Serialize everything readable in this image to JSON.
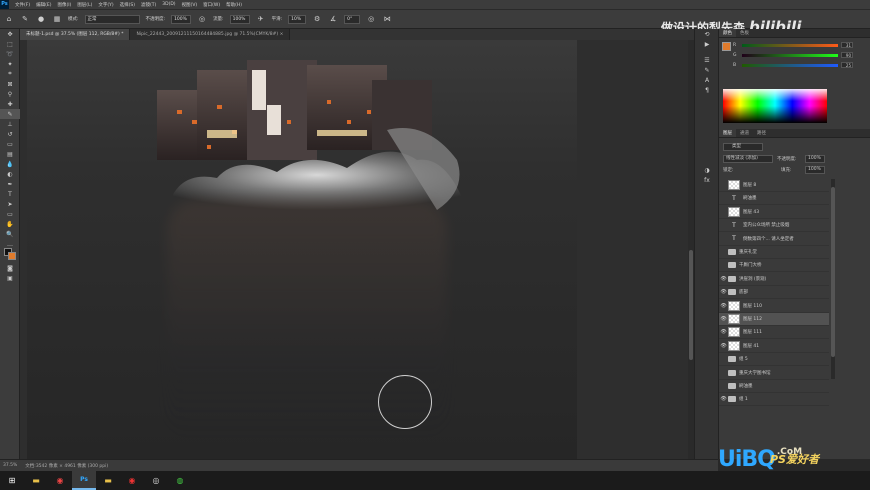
{
  "app": {
    "logo": "Ps"
  },
  "menu": [
    "文件(F)",
    "编辑(E)",
    "图像(I)",
    "图层(L)",
    "文字(Y)",
    "选择(S)",
    "滤镜(T)",
    "3D(D)",
    "视图(V)",
    "窗口(W)",
    "帮助(H)"
  ],
  "options": {
    "mode_label": "模式:",
    "mode_value": "正常",
    "opacity_label": "不透明度:",
    "opacity_value": "100%",
    "flow_label": "流量:",
    "flow_value": "100%",
    "smooth_label": "平滑:",
    "smooth_value": "10%",
    "angle_value": "0°"
  },
  "tabs": [
    {
      "label": "未标题-1.psd @ 37.5% (图层 112, RGB/8#) *"
    },
    {
      "label": "Nipic_22443_20091211150164484885.jpg @ 71.5%(CMYK/8#) ×"
    }
  ],
  "watermark": {
    "text": "做设计的梨先森",
    "brand": "bilibili"
  },
  "color_panel": {
    "tabs": [
      "颜色",
      "色板"
    ],
    "r": "31",
    "g": "90",
    "b": "25",
    "accent": "#e07b2c"
  },
  "adjust_tabs": [
    "图层",
    "通道",
    "路径"
  ],
  "layers_panel": {
    "kind_filter": "类型",
    "blend_mode": "线性减淡 (添加)",
    "opacity_label": "不透明度:",
    "opacity_value": "100%",
    "lock_label": "锁定:",
    "fill_label": "填充:",
    "fill_value": "100%",
    "items": [
      {
        "name": "图层 8",
        "type": "pixel",
        "visible": false
      },
      {
        "name": "刷油墨",
        "type": "text",
        "visible": false
      },
      {
        "name": "图层 43",
        "type": "pixel",
        "visible": false
      },
      {
        "name": "室内公众场所 禁止吸烟",
        "type": "text",
        "visible": false
      },
      {
        "name": "倒数第四个... 请人坐定者",
        "type": "text",
        "visible": false
      },
      {
        "name": "重庆礼堂",
        "type": "folder",
        "visible": false
      },
      {
        "name": "千厮门大桥",
        "type": "folder",
        "visible": false
      },
      {
        "name": "洪崖洞 (景观)",
        "type": "folder",
        "visible": true
      },
      {
        "name": "底部",
        "type": "folder",
        "visible": true
      },
      {
        "name": "图层 110",
        "type": "pixel",
        "visible": true
      },
      {
        "name": "图层 112",
        "type": "pixel",
        "visible": true,
        "selected": true
      },
      {
        "name": "图层 111",
        "type": "pixel",
        "visible": true
      },
      {
        "name": "图层 41",
        "type": "pixel",
        "visible": true
      },
      {
        "name": "组 5",
        "type": "folder",
        "visible": false
      },
      {
        "name": "重庆大学图书馆",
        "type": "folder",
        "visible": false
      },
      {
        "name": "刷油墨",
        "type": "folder",
        "visible": false
      },
      {
        "name": "组 1",
        "type": "folder",
        "visible": true
      }
    ]
  },
  "status": {
    "zoom": "37.5%",
    "doc": "文档:3542 像素 × 4961 像素 (300 ppi)"
  },
  "site_watermark": {
    "brand": "UiBQ",
    "sub": ".CoM",
    "cn": "PS爱好者"
  }
}
